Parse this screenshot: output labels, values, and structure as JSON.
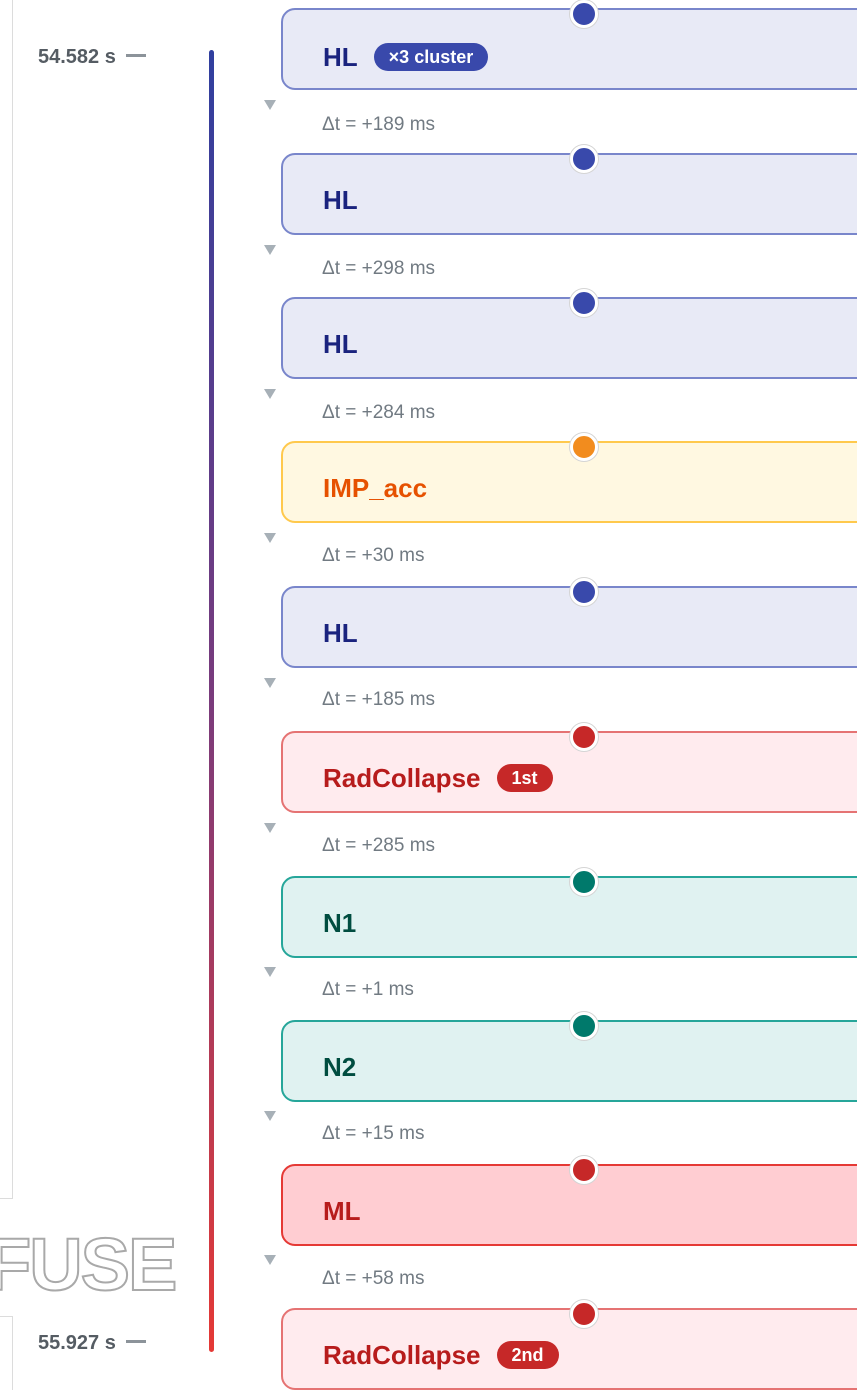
{
  "timeline": {
    "start_time": "54.582 s",
    "end_time": "55.927 s",
    "watermark": "FUSE"
  },
  "events": [
    {
      "label": "HL",
      "badge": "×3 cluster",
      "color": "blue"
    },
    {
      "label": "HL",
      "color": "blue"
    },
    {
      "label": "HL",
      "color": "blue"
    },
    {
      "label": "IMP_acc",
      "color": "orange"
    },
    {
      "label": "HL",
      "color": "blue"
    },
    {
      "label": "RadCollapse",
      "badge": "1st",
      "color": "red"
    },
    {
      "label": "N1",
      "color": "teal"
    },
    {
      "label": "N2",
      "color": "teal"
    },
    {
      "label": "ML",
      "color": "strongred"
    },
    {
      "label": "RadCollapse",
      "badge": "2nd",
      "color": "red"
    }
  ],
  "intervals": [
    "Δt = +189 ms",
    "Δt = +298 ms",
    "Δt = +284 ms",
    "Δt = +30 ms",
    "Δt = +185 ms",
    "Δt = +285 ms",
    "Δt = +1 ms",
    "Δt = +15 ms",
    "Δt = +58 ms"
  ],
  "colors": {
    "blue": "#3949ab",
    "orange": "#f28c1e",
    "red": "#c62828",
    "teal": "#00796b",
    "strongred": "#e53935"
  }
}
